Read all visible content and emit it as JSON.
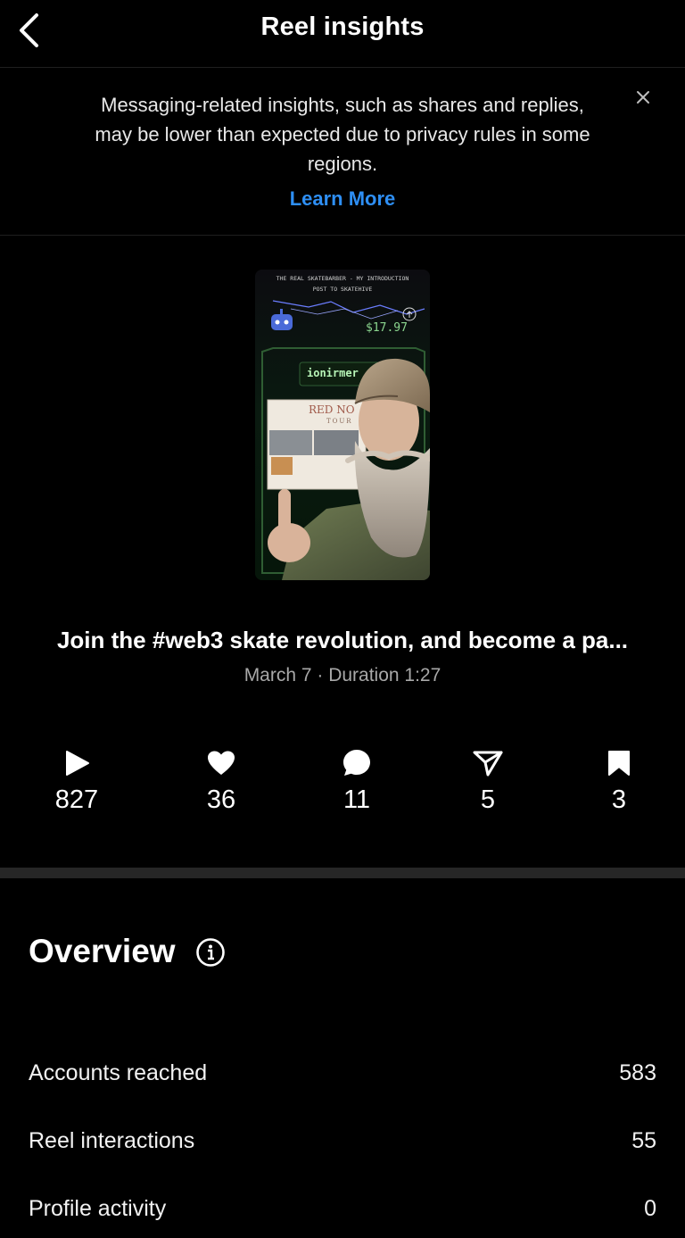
{
  "header": {
    "title": "Reel insights",
    "back_icon": "chevron-left-icon"
  },
  "banner": {
    "text": "Messaging-related insights, such as shares and replies, may be lower than expected due to privacy rules in some regions.",
    "link_label": "Learn More",
    "link_color": "#2e8ff5",
    "close_icon": "close-icon"
  },
  "thumbnail": {
    "top_text": "THE REAL SKATEBARBER - MY INTRODUCTION POST TO SKATEHIVE",
    "amount": "$17.97",
    "username": "ionirmer",
    "poster_title": "RED NO",
    "poster_sub": "TOUR"
  },
  "reel": {
    "caption": "Join the #web3 skate revolution, and become a pa...",
    "meta": "March 7 · Duration 1:27"
  },
  "stats": [
    {
      "icon": "play-icon",
      "value": "827"
    },
    {
      "icon": "heart-icon",
      "value": "36"
    },
    {
      "icon": "comment-icon",
      "value": "11"
    },
    {
      "icon": "share-icon",
      "value": "5"
    },
    {
      "icon": "bookmark-icon",
      "value": "3"
    }
  ],
  "overview": {
    "title": "Overview",
    "info_icon": "info-icon",
    "rows": [
      {
        "label": "Accounts reached",
        "value": "583"
      },
      {
        "label": "Reel interactions",
        "value": "55"
      },
      {
        "label": "Profile activity",
        "value": "0"
      }
    ]
  }
}
